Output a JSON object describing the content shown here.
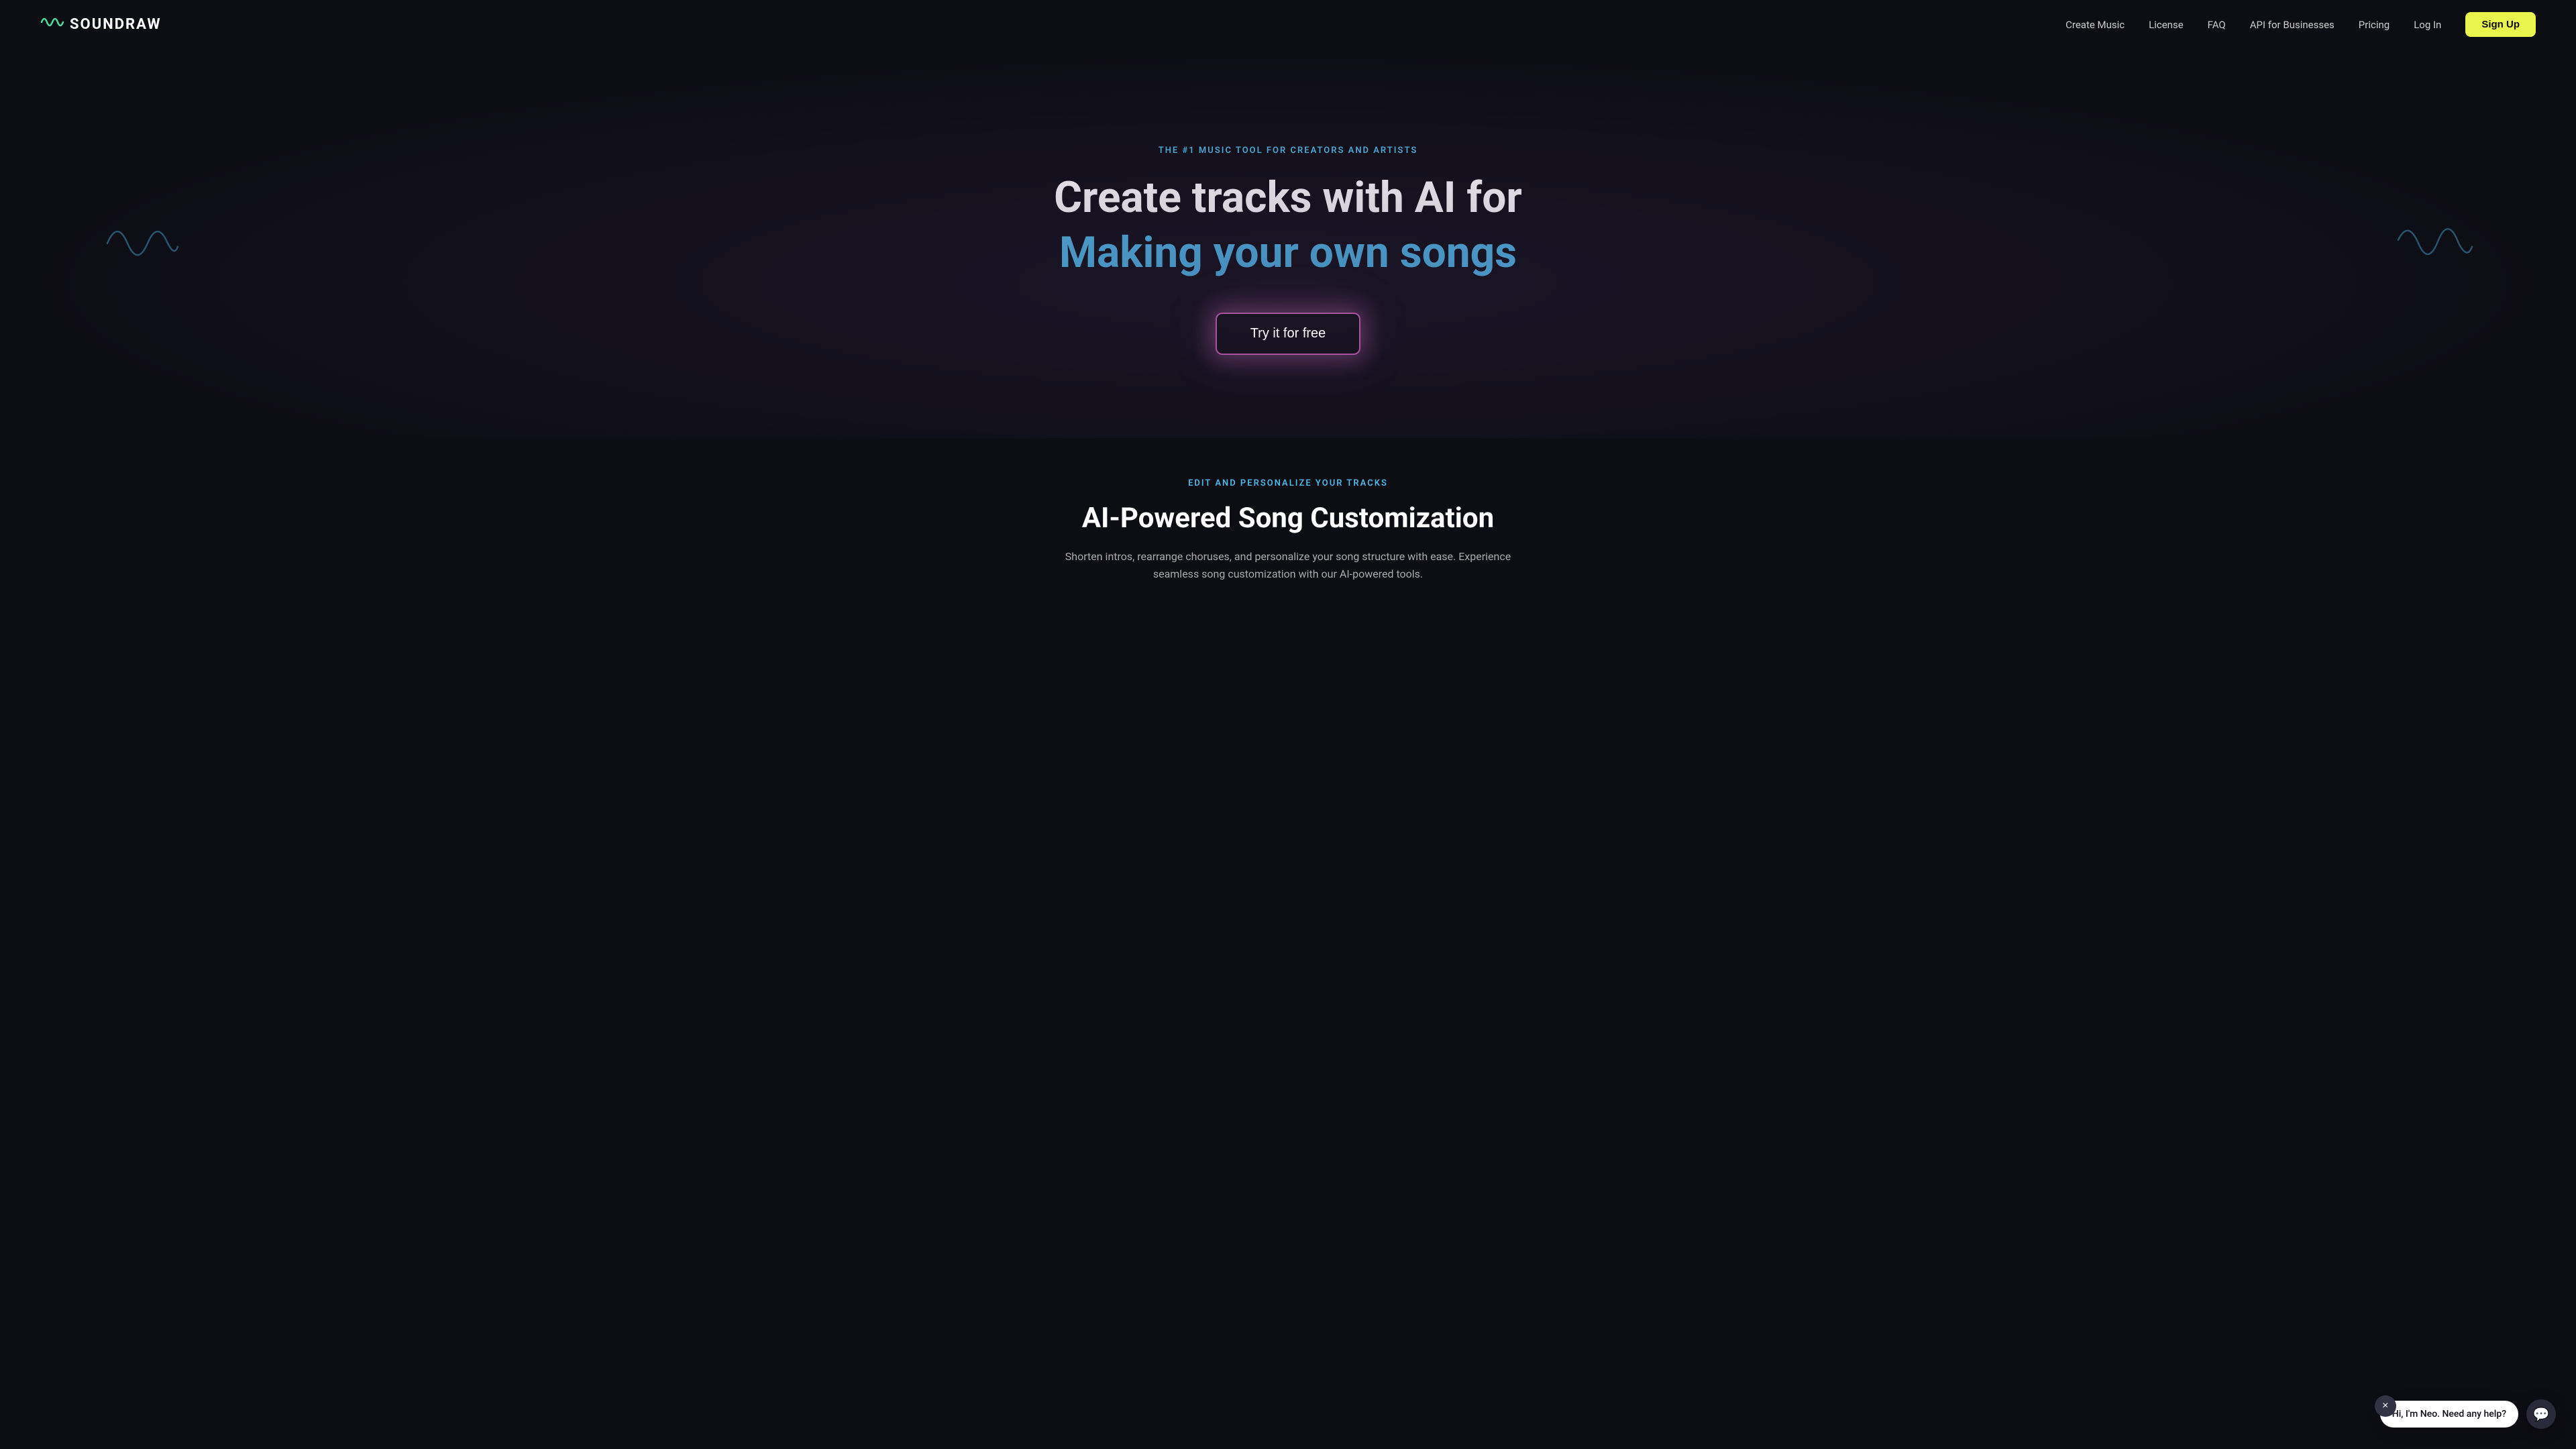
{
  "navbar": {
    "logo_icon": "∿",
    "logo_text": "SOUNDRAW",
    "links": [
      {
        "label": "Create Music",
        "href": "#"
      },
      {
        "label": "License",
        "href": "#"
      },
      {
        "label": "FAQ",
        "href": "#"
      },
      {
        "label": "API for Businesses",
        "href": "#"
      },
      {
        "label": "Pricing",
        "href": "#"
      },
      {
        "label": "Log In",
        "href": "#"
      }
    ],
    "signup_label": "Sign Up"
  },
  "hero": {
    "subtitle": "THE #1 MUSIC TOOL FOR CREATORS AND ARTISTS",
    "title_line1": "Create tracks with AI for",
    "title_line2": "Making your own songs",
    "cta_label": "Try it for free"
  },
  "lower": {
    "subtitle": "EDIT AND PERSONALIZE YOUR TRACKS",
    "title": "AI-Powered Song Customization",
    "description": "Shorten intros, rearrange choruses, and personalize your song structure with ease. Experience seamless song customization with our AI-powered tools."
  },
  "chat": {
    "message": "Hi, I'm Neo. Need any help?",
    "close_label": "×"
  },
  "colors": {
    "accent_cyan": "#4db8e8",
    "accent_green": "#4ade9b",
    "accent_yellow": "#e8f54a",
    "accent_purple": "#a855a0",
    "bg_dark": "#0d0d14"
  }
}
